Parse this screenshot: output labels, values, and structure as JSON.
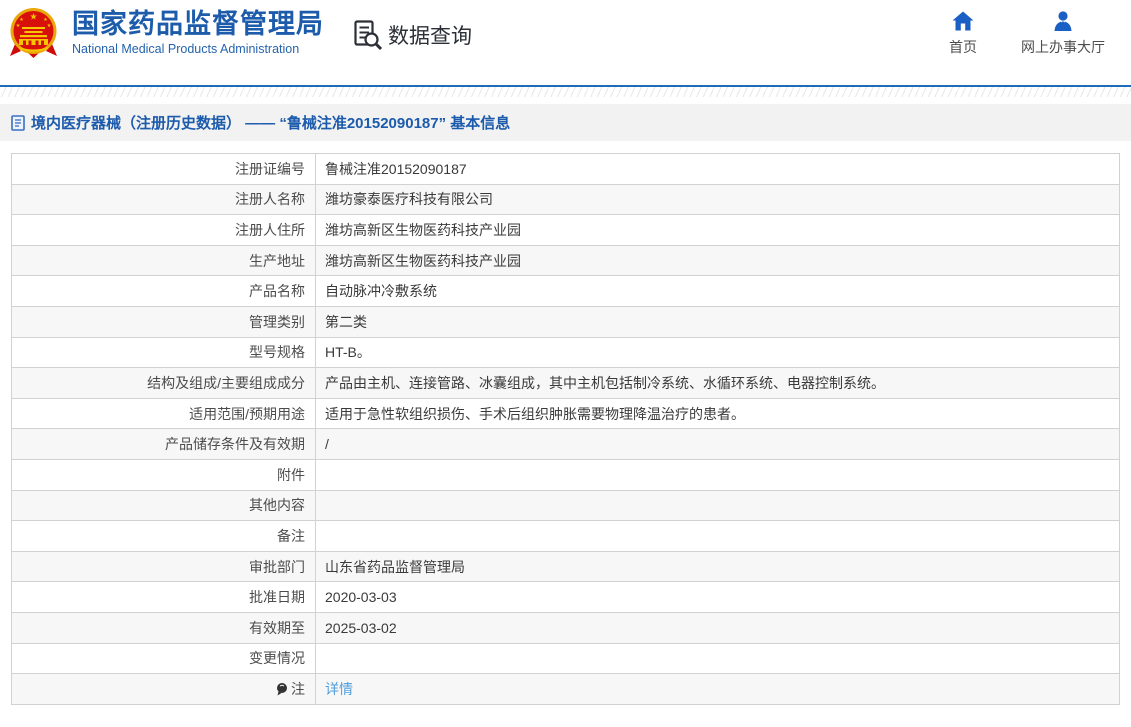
{
  "header": {
    "title": "国家药品监督管理局",
    "subtitle": "National Medical Products Administration",
    "section_label": "数据查询",
    "nav": [
      {
        "label": "首页",
        "icon": "home-icon"
      },
      {
        "label": "网上办事大厅",
        "icon": "user-icon"
      }
    ]
  },
  "breadcrumb": {
    "title": "境内医疗器械（注册历史数据） —— “鲁械注准20152090187” 基本信息"
  },
  "table": {
    "rows": [
      {
        "label": "注册证编号",
        "value": "鲁械注准20152090187"
      },
      {
        "label": "注册人名称",
        "value": "潍坊豪泰医疗科技有限公司"
      },
      {
        "label": "注册人住所",
        "value": "潍坊高新区生物医药科技产业园"
      },
      {
        "label": "生产地址",
        "value": "潍坊高新区生物医药科技产业园"
      },
      {
        "label": "产品名称",
        "value": "自动脉冲冷敷系统"
      },
      {
        "label": "管理类别",
        "value": "第二类"
      },
      {
        "label": "型号规格",
        "value": "HT-B。"
      },
      {
        "label": "结构及组成/主要组成成分",
        "value": "产品由主机、连接管路、冰囊组成，其中主机包括制冷系统、水循环系统、电器控制系统。"
      },
      {
        "label": "适用范围/预期用途",
        "value": "适用于急性软组织损伤、手术后组织肿胀需要物理降温治疗的患者。"
      },
      {
        "label": "产品储存条件及有效期",
        "value": "/"
      },
      {
        "label": "附件",
        "value": ""
      },
      {
        "label": "其他内容",
        "value": ""
      },
      {
        "label": "备注",
        "value": ""
      },
      {
        "label": "审批部门",
        "value": "山东省药品监督管理局"
      },
      {
        "label": "批准日期",
        "value": "2020-03-03"
      },
      {
        "label": "有效期至",
        "value": "2025-03-02"
      },
      {
        "label": "变更情况",
        "value": ""
      },
      {
        "label": "注",
        "value": "详情",
        "link": true,
        "icon": "note-icon"
      }
    ]
  },
  "colors": {
    "brand_blue": "#1d5cab",
    "icon_blue": "#1a5fc4",
    "divider_blue": "#1e6bb8",
    "title_bar_bg": "#f2f2f2",
    "table_border": "#d2d2d2",
    "stripe_bg": "#f7f7f7",
    "link_blue": "#4f9ddb"
  }
}
